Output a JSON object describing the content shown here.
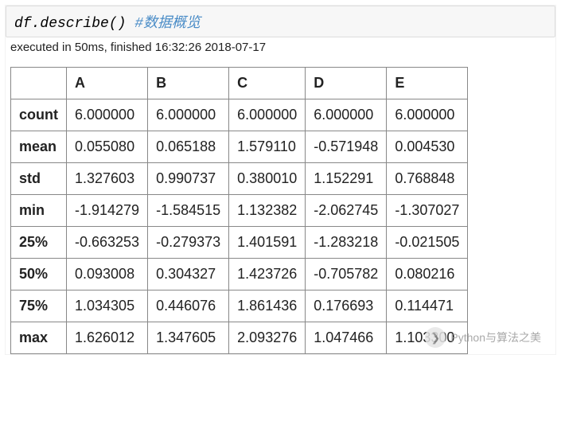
{
  "code": {
    "expression": "df.describe()",
    "comment": "#数据概览"
  },
  "execution": {
    "status_text": "executed in 50ms, finished 16:32:26 2018-07-17"
  },
  "table": {
    "columns": [
      "A",
      "B",
      "C",
      "D",
      "E"
    ],
    "index": [
      "count",
      "mean",
      "std",
      "min",
      "25%",
      "50%",
      "75%",
      "max"
    ],
    "rows": [
      [
        "6.000000",
        "6.000000",
        "6.000000",
        "6.000000",
        "6.000000"
      ],
      [
        "0.055080",
        "0.065188",
        "1.579110",
        "-0.571948",
        "0.004530"
      ],
      [
        "1.327603",
        "0.990737",
        "0.380010",
        "1.152291",
        "0.768848"
      ],
      [
        "-1.914279",
        "-1.584515",
        "1.132382",
        "-2.062745",
        "-1.307027"
      ],
      [
        "-0.663253",
        "-0.279373",
        "1.401591",
        "-1.283218",
        "-0.021505"
      ],
      [
        "0.093008",
        "0.304327",
        "1.423726",
        "-0.705782",
        "0.080216"
      ],
      [
        "1.034305",
        "0.446076",
        "1.861436",
        "0.176693",
        "0.114471"
      ],
      [
        "1.626012",
        "1.347605",
        "2.093276",
        "1.047466",
        "1.103300"
      ]
    ]
  },
  "watermark": {
    "icon_glyph": "❯",
    "text": "Python与算法之美"
  }
}
